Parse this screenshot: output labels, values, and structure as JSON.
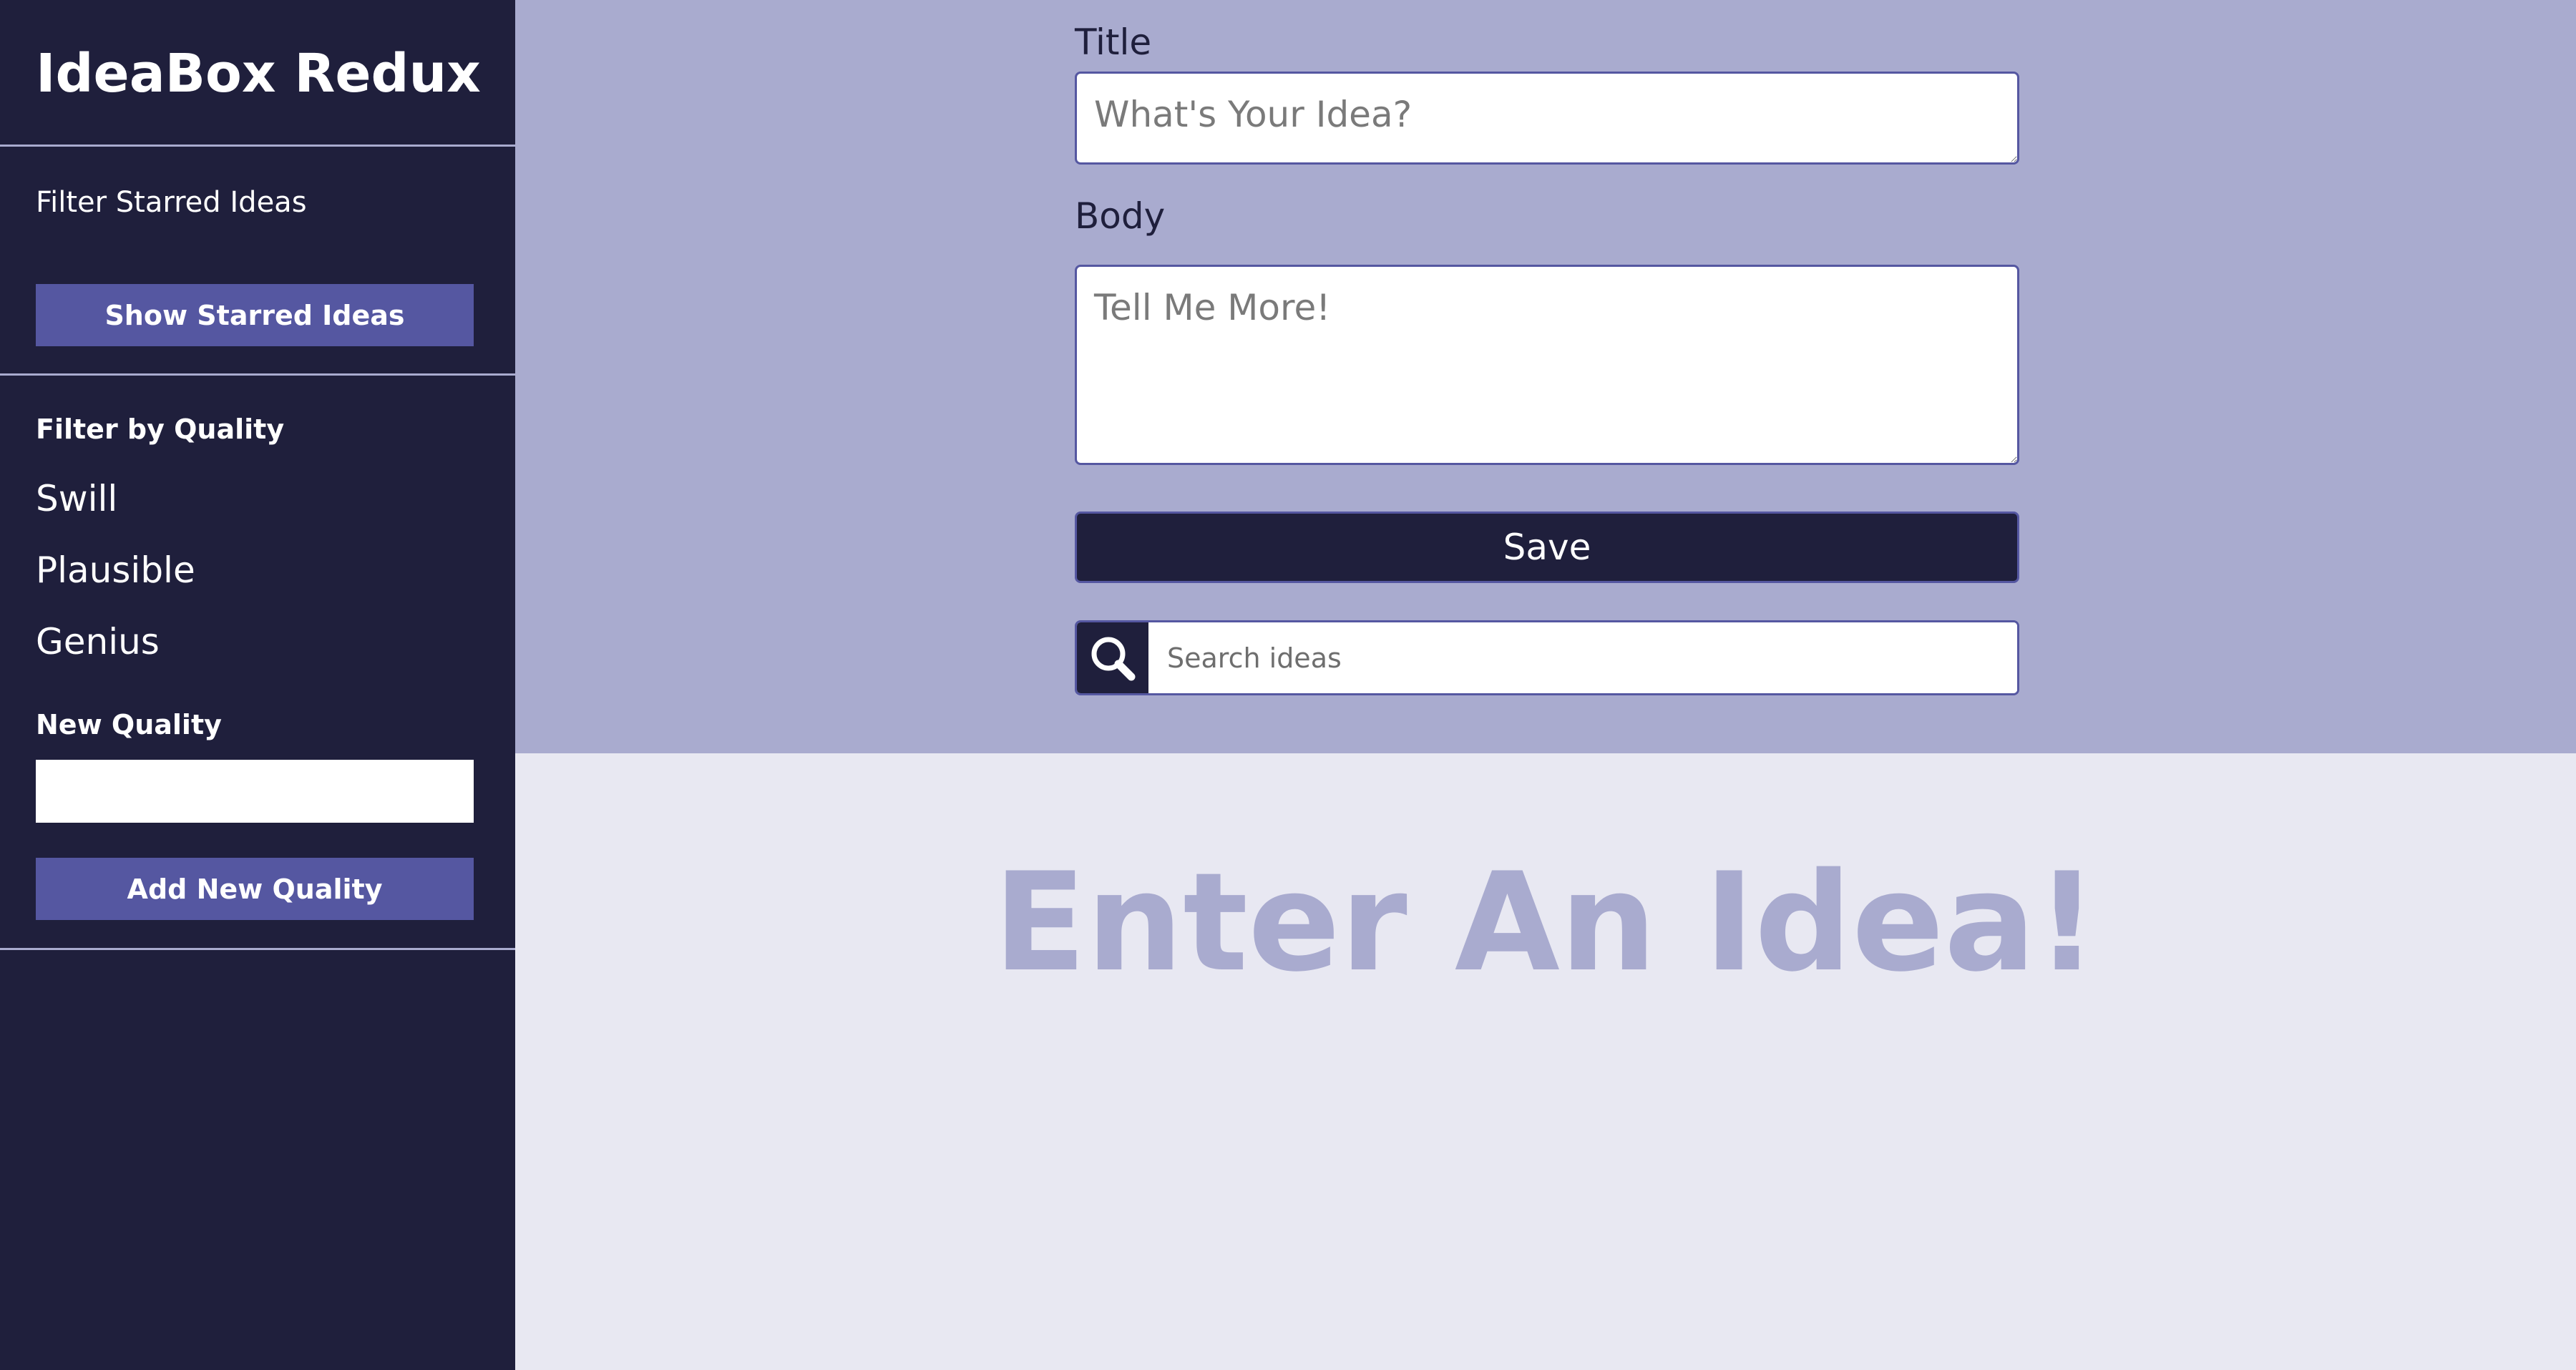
{
  "app": {
    "title": "IdeaBox Redux"
  },
  "sidebar": {
    "filter_starred_label": "Filter Starred Ideas",
    "show_starred_button": "Show Starred Ideas",
    "filter_quality_heading": "Filter by Quality",
    "qualities": [
      "Swill",
      "Plausible",
      "Genius"
    ],
    "new_quality_heading": "New Quality",
    "new_quality_value": "",
    "add_quality_button": "Add New Quality"
  },
  "form": {
    "title_label": "Title",
    "title_placeholder": "What's Your Idea?",
    "title_value": "",
    "body_label": "Body",
    "body_placeholder": "Tell Me More!",
    "body_value": "",
    "save_button": "Save"
  },
  "search": {
    "icon": "search-icon",
    "placeholder": "Search ideas",
    "value": ""
  },
  "ideas": {
    "empty_message": "Enter An Idea!"
  },
  "colors": {
    "sidebar_bg": "#1f1f3c",
    "accent": "#5557a1",
    "header_bg": "#a9abcf",
    "content_bg": "#e8e8f2",
    "button_dark": "#1f1f3c"
  }
}
